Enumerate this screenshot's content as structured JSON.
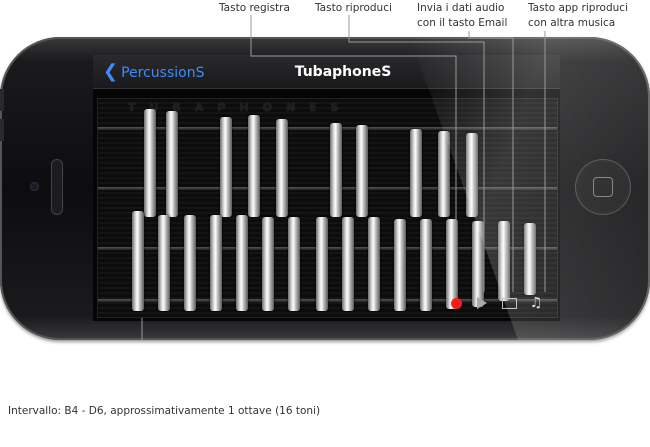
{
  "callouts": {
    "record": "Tasto registra",
    "play": "Tasto riproduci",
    "email_line1": "Invia i dati audio",
    "email_line2": "con il tasto Email",
    "music_line1": "Tasto app riproduci",
    "music_line2": "con altra musica"
  },
  "navbar": {
    "back_label": "PercussionS",
    "title": "TubaphoneS"
  },
  "instrument": {
    "brand_text": "TUBAPHONES",
    "bar_count": 26
  },
  "controls": {
    "record_color": "#ff1a1a",
    "icons": [
      "record-icon",
      "play-icon",
      "mail-icon",
      "music-note-icon"
    ]
  },
  "caption": "Intervallo: B4 - D6, approssimativamente 1 ottave (16 toni)",
  "colors": {
    "accent": "#3b8cff",
    "background": "#ffffff",
    "callout_line": "#999999"
  }
}
